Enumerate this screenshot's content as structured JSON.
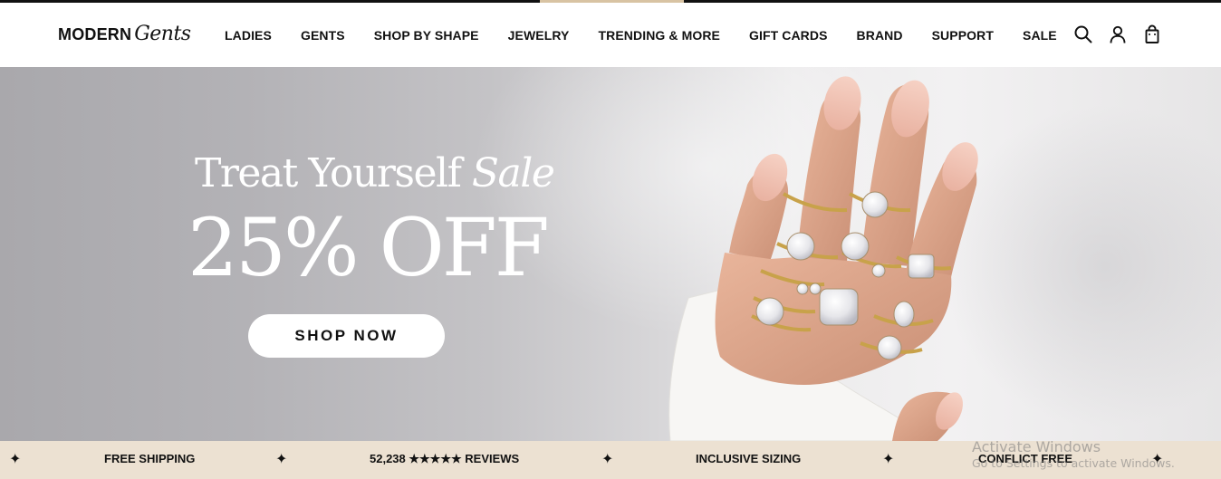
{
  "brand": {
    "logo_word1": "MODERN",
    "logo_word2": "Gents"
  },
  "nav": {
    "items": [
      "LADIES",
      "GENTS",
      "SHOP BY SHAPE",
      "JEWELRY",
      "TRENDING & MORE",
      "GIFT CARDS",
      "BRAND",
      "SUPPORT",
      "SALE"
    ]
  },
  "header_icons": [
    "search-icon",
    "account-icon",
    "cart-bag-icon"
  ],
  "hero": {
    "subtitle_regular": "Treat Yourself",
    "subtitle_italic": "Sale",
    "title": "25% OFF",
    "cta_label": "SHOP NOW"
  },
  "usp_bar": {
    "separator": "✦",
    "items": [
      "FREE SHIPPING",
      "52,238 ★★★★★ REVIEWS",
      "INCLUSIVE SIZING",
      "CONFLICT FREE"
    ]
  },
  "os_watermark": {
    "line1": "Activate Windows",
    "line2": "Go to Settings to activate Windows."
  },
  "colors": {
    "accent": "#d8c3a3",
    "usp_background": "#ece1d2",
    "text": "#111111",
    "button_background": "#ffffff"
  }
}
